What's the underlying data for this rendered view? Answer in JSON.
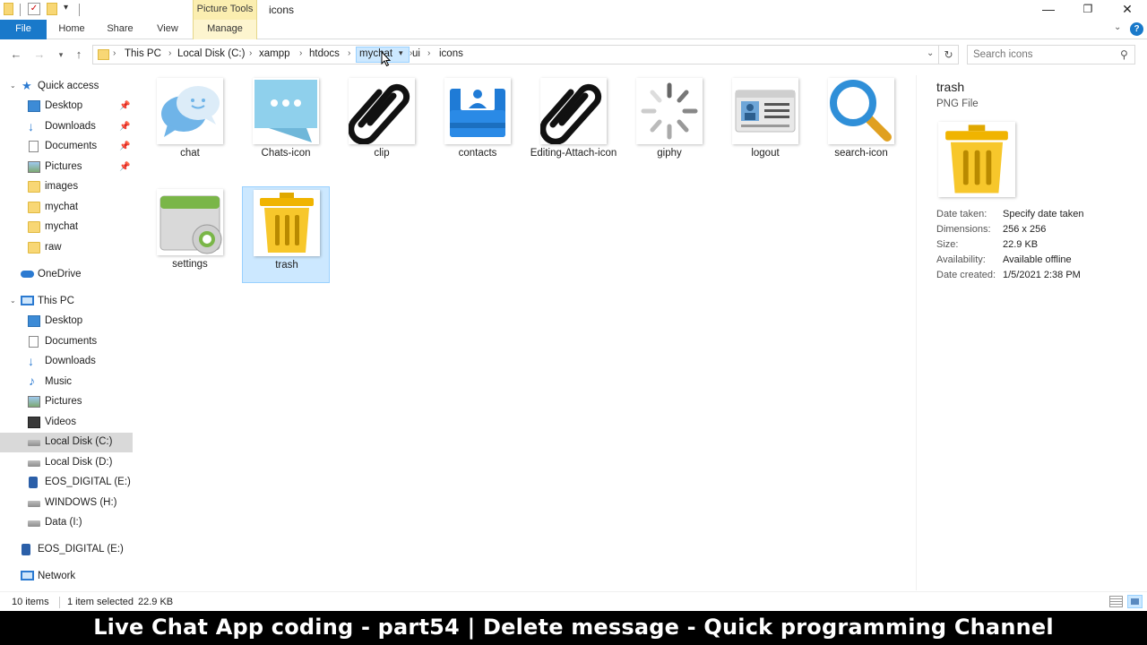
{
  "window": {
    "title": "icons",
    "context_tab": "Picture Tools",
    "controls": {
      "minimize": "—",
      "maximize": "❐",
      "close": "✕"
    }
  },
  "ribbon": {
    "tabs": [
      {
        "label": "File"
      },
      {
        "label": "Home"
      },
      {
        "label": "Share"
      },
      {
        "label": "View"
      },
      {
        "label": "Manage"
      }
    ]
  },
  "address": {
    "crumbs": [
      "This PC",
      "Local Disk (C:)",
      "xampp",
      "htdocs",
      "mychat",
      "ui",
      "icons"
    ],
    "search_placeholder": "Search icons"
  },
  "nav": {
    "quick_access": {
      "label": "Quick access",
      "items": [
        {
          "label": "Desktop",
          "pinned": true,
          "icon": "desktop-icon"
        },
        {
          "label": "Downloads",
          "pinned": true,
          "icon": "download-icon"
        },
        {
          "label": "Documents",
          "pinned": true,
          "icon": "documents-icon"
        },
        {
          "label": "Pictures",
          "pinned": true,
          "icon": "pictures-icon"
        },
        {
          "label": "images",
          "pinned": false,
          "icon": "folder-icon"
        },
        {
          "label": "mychat",
          "pinned": false,
          "icon": "folder-icon"
        },
        {
          "label": "mychat",
          "pinned": false,
          "icon": "folder-icon"
        },
        {
          "label": "raw",
          "pinned": false,
          "icon": "folder-icon"
        }
      ]
    },
    "onedrive": {
      "label": "OneDrive"
    },
    "this_pc": {
      "label": "This PC",
      "items": [
        {
          "label": "Desktop",
          "icon": "desktop-icon"
        },
        {
          "label": "Documents",
          "icon": "documents-icon"
        },
        {
          "label": "Downloads",
          "icon": "download-icon"
        },
        {
          "label": "Music",
          "icon": "music-icon"
        },
        {
          "label": "Pictures",
          "icon": "pictures-icon"
        },
        {
          "label": "Videos",
          "icon": "videos-icon"
        },
        {
          "label": "Local Disk (C:)",
          "icon": "drive-icon",
          "selected": true
        },
        {
          "label": "Local Disk (D:)",
          "icon": "drive-icon"
        },
        {
          "label": "EOS_DIGITAL (E:)",
          "icon": "usb-drive-icon"
        },
        {
          "label": "WINDOWS (H:)",
          "icon": "drive-icon"
        },
        {
          "label": "Data (I:)",
          "icon": "drive-icon"
        }
      ]
    },
    "eos": {
      "label": "EOS_DIGITAL (E:)"
    },
    "network": {
      "label": "Network"
    }
  },
  "files": [
    {
      "name": "chat",
      "icon": "chat-bubbles-icon"
    },
    {
      "name": "Chats-icon",
      "icon": "chat-bubble-dots-icon"
    },
    {
      "name": "clip",
      "icon": "paperclip-icon"
    },
    {
      "name": "contacts",
      "icon": "contacts-icon"
    },
    {
      "name": "Editing-Attach-icon",
      "icon": "paperclip-icon"
    },
    {
      "name": "giphy",
      "icon": "spinner-icon"
    },
    {
      "name": "logout",
      "icon": "id-card-icon"
    },
    {
      "name": "search-icon",
      "icon": "magnifier-icon"
    },
    {
      "name": "settings",
      "icon": "settings-icon"
    },
    {
      "name": "trash",
      "icon": "trash-icon",
      "selected": true
    }
  ],
  "details": {
    "name": "trash",
    "type": "PNG File",
    "properties": [
      {
        "key": "Date taken:",
        "value": "Specify date taken"
      },
      {
        "key": "Dimensions:",
        "value": "256 x 256"
      },
      {
        "key": "Size:",
        "value": "22.9 KB"
      },
      {
        "key": "Availability:",
        "value": "Available offline"
      },
      {
        "key": "Date created:",
        "value": "1/5/2021 2:38 PM"
      }
    ]
  },
  "status": {
    "item_count": "10 items",
    "selection": "1 item selected",
    "selection_size": "22.9 KB"
  },
  "caption": "Live Chat App coding - part54 | Delete message - Quick programming Channel"
}
